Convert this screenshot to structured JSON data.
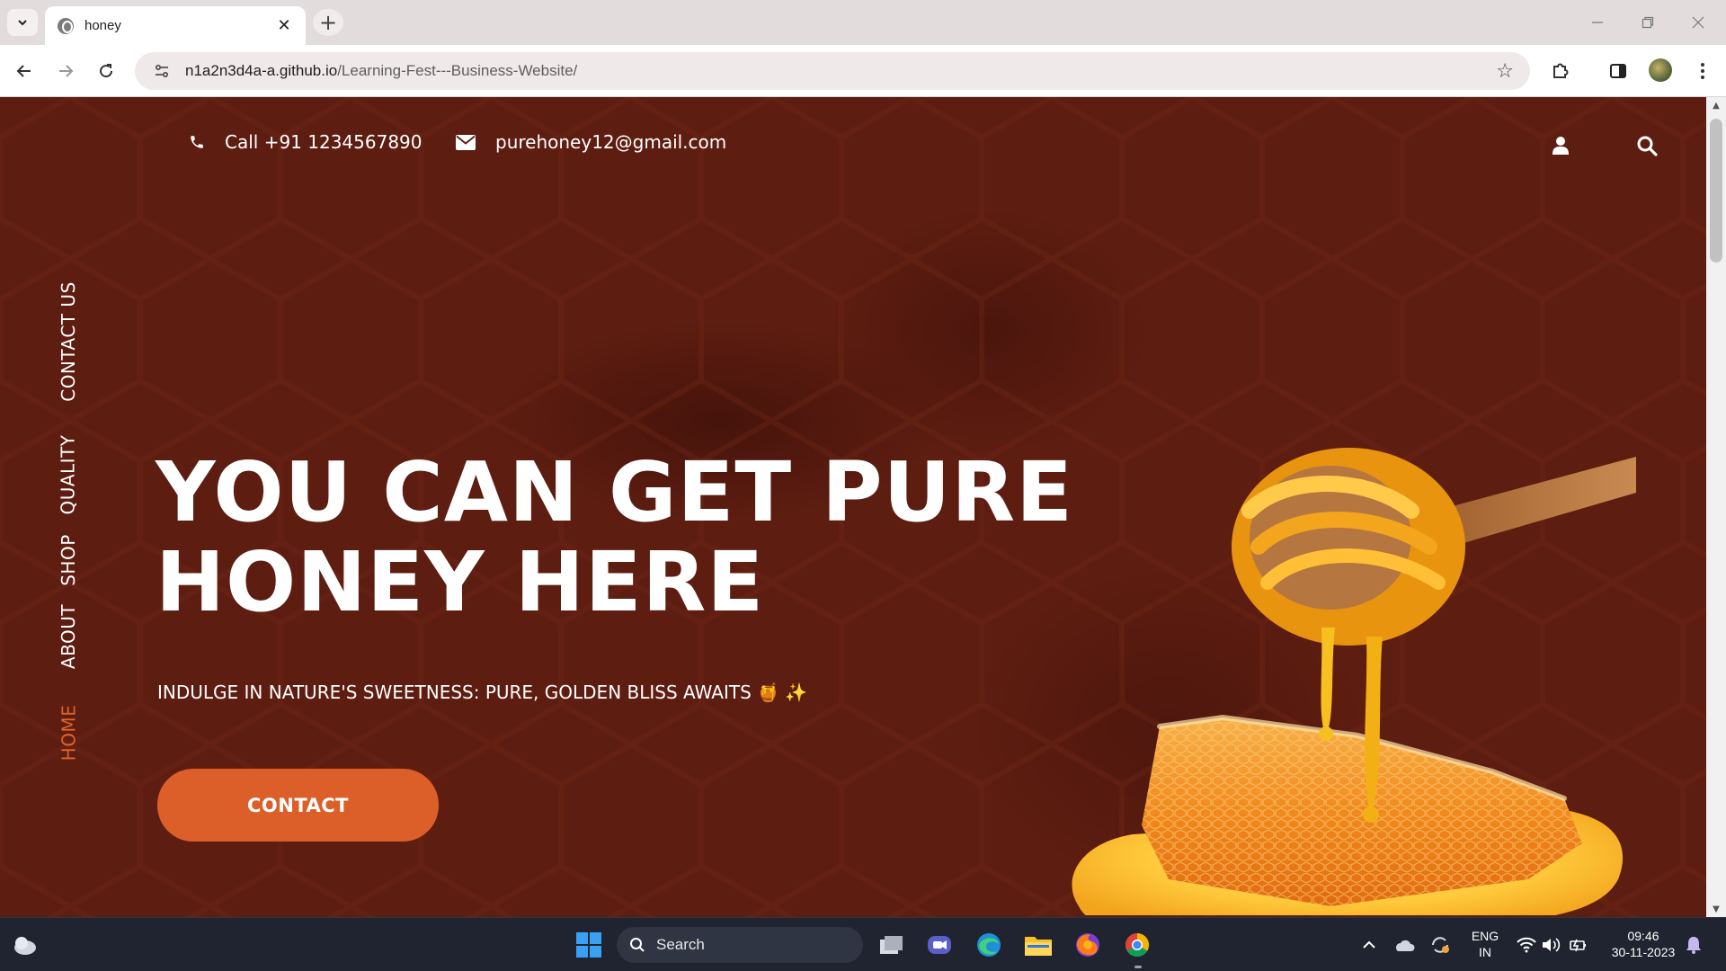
{
  "browser": {
    "tab_title": "honey",
    "url_host": "n1a2n3d4a-a.github.io",
    "url_path": "/Learning-Fest---Business-Website/"
  },
  "page": {
    "phone": "Call +91 1234567890",
    "email": "purehoney12@gmail.com",
    "side_nav": [
      "CONTACT US",
      "QUALITY",
      "SHOP",
      "ABOUT",
      "HOME"
    ],
    "active_nav": "HOME",
    "hero_title_line1": "YOU CAN GET PURE",
    "hero_title_line2": "HONEY HERE",
    "hero_subtitle": "INDULGE IN NATURE'S SWEETNESS: PURE, GOLDEN BLISS AWAITS 🍯 ✨",
    "cta_label": "CONTACT",
    "colors": {
      "background": "#5e1d11",
      "accent": "#dc5f2a",
      "text": "#ffffff"
    }
  },
  "taskbar": {
    "search_label": "Search",
    "language": "ENG",
    "region": "IN",
    "time": "09:46",
    "date": "30-11-2023"
  }
}
